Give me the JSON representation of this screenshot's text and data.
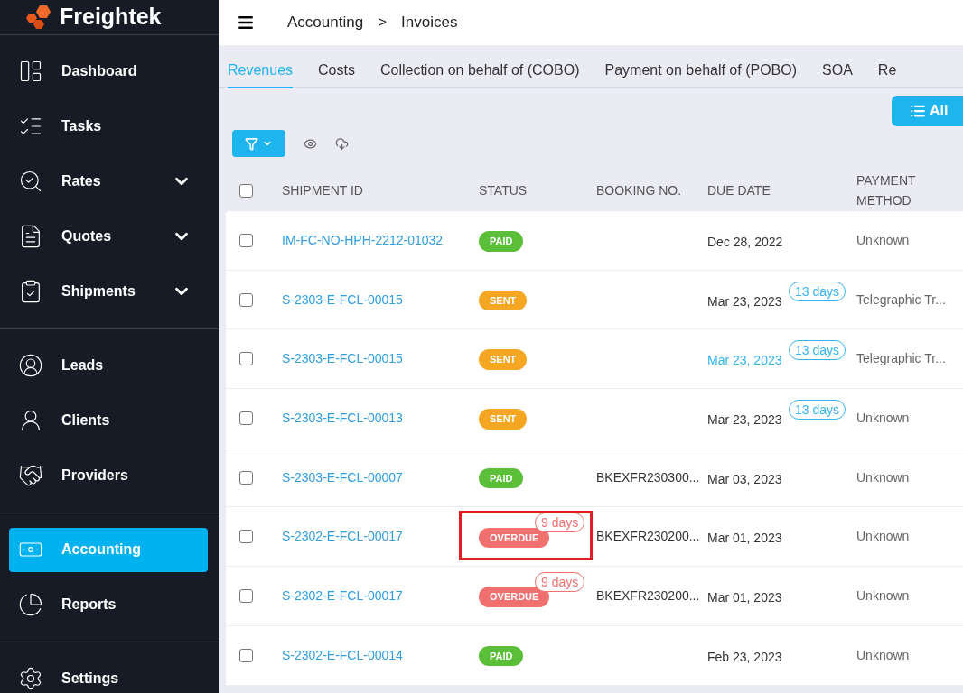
{
  "brand": {
    "name": "Freightek"
  },
  "sidebar": {
    "groups": [
      [
        {
          "label": "Dashboard",
          "expandable": false,
          "selected": false
        },
        {
          "label": "Tasks",
          "expandable": false,
          "selected": false
        },
        {
          "label": "Rates",
          "expandable": true,
          "selected": false
        },
        {
          "label": "Quotes",
          "expandable": true,
          "selected": false
        },
        {
          "label": "Shipments",
          "expandable": true,
          "selected": false
        }
      ],
      [
        {
          "label": "Leads",
          "expandable": false,
          "selected": false
        },
        {
          "label": "Clients",
          "expandable": false,
          "selected": false
        },
        {
          "label": "Providers",
          "expandable": false,
          "selected": false
        }
      ],
      [
        {
          "label": "Accounting",
          "expandable": false,
          "selected": true
        },
        {
          "label": "Reports",
          "expandable": false,
          "selected": false
        }
      ],
      [
        {
          "label": "Settings",
          "expandable": false,
          "selected": false
        }
      ]
    ]
  },
  "breadcrumb": [
    "Accounting",
    ">",
    "Invoices"
  ],
  "tabs": [
    {
      "label": "Revenues",
      "selected": true
    },
    {
      "label": "Costs",
      "selected": false
    },
    {
      "label": "Collection on behalf of (COBO)",
      "selected": false
    },
    {
      "label": "Payment on behalf of (POBO)",
      "selected": false
    },
    {
      "label": "SOA",
      "selected": false
    },
    {
      "label": "Re",
      "selected": false
    }
  ],
  "view_button": {
    "label": "All"
  },
  "table": {
    "select_all": {
      "checked": false
    },
    "columns": [
      "SHIPMENT ID",
      "STATUS",
      "BOOKING NO.",
      "DUE DATE",
      "PAYMENT METHOD"
    ],
    "rows": [
      {
        "checked": false,
        "shipment_id": "IM-FC-NO-HPH-2212-01032",
        "status": {
          "text": "PAID",
          "color": "#5cbf3a"
        },
        "booking": "",
        "due_date": "Dec 28, 2022",
        "date_highlighted": false,
        "payment": "Unknown",
        "highlighted": false
      },
      {
        "checked": false,
        "shipment_id": "S-2303-E-FCL-00015",
        "status": {
          "text": "SENT",
          "color": "#f5a623"
        },
        "booking": "",
        "due_date": "Mar 23, 2023",
        "date_highlighted": false,
        "days": {
          "kind": "remaining",
          "text": "13 days",
          "color": "#35b3ee"
        },
        "payment": "Telegraphic Tr...",
        "highlighted": false
      },
      {
        "checked": false,
        "shipment_id": "S-2303-E-FCL-00015",
        "status": {
          "text": "SENT",
          "color": "#f5a623"
        },
        "booking": "",
        "due_date": "Mar 23, 2023",
        "date_highlighted": true,
        "days": {
          "kind": "remaining",
          "text": "13 days",
          "color": "#35b3ee"
        },
        "payment": "Telegraphic Tr...",
        "highlighted": false
      },
      {
        "checked": false,
        "shipment_id": "S-2303-E-FCL-00013",
        "status": {
          "text": "SENT",
          "color": "#f5a623"
        },
        "booking": "",
        "due_date": "Mar 23, 2023",
        "date_highlighted": false,
        "days": {
          "kind": "remaining",
          "text": "13 days",
          "color": "#35b3ee"
        },
        "payment": "Unknown",
        "highlighted": false
      },
      {
        "checked": false,
        "shipment_id": "S-2303-E-FCL-00007",
        "status": {
          "text": "PAID",
          "color": "#5cbf3a"
        },
        "booking": "BKEXFR230300...",
        "due_date": "Mar 03, 2023",
        "date_highlighted": false,
        "payment": "Unknown",
        "highlighted": false
      },
      {
        "checked": false,
        "shipment_id": "S-2302-E-FCL-00017",
        "status": {
          "text": "OVERDUE",
          "color": "#f07070"
        },
        "booking": "BKEXFR230200...",
        "due_date": "Mar 01, 2023",
        "date_highlighted": false,
        "days": {
          "kind": "overdue",
          "text": "9 days",
          "color": "#f07070"
        },
        "payment": "Unknown",
        "highlighted": true
      },
      {
        "checked": false,
        "shipment_id": "S-2302-E-FCL-00017",
        "status": {
          "text": "OVERDUE",
          "color": "#f07070"
        },
        "booking": "BKEXFR230200...",
        "due_date": "Mar 01, 2023",
        "date_highlighted": false,
        "days": {
          "kind": "overdue",
          "text": "9 days",
          "color": "#f07070"
        },
        "payment": "Unknown",
        "highlighted": false
      },
      {
        "checked": false,
        "shipment_id": "S-2302-E-FCL-00014",
        "status": {
          "text": "PAID",
          "color": "#5cbf3a"
        },
        "booking": "",
        "due_date": "Feb 23, 2023",
        "date_highlighted": false,
        "payment": "Unknown",
        "highlighted": false
      }
    ]
  }
}
